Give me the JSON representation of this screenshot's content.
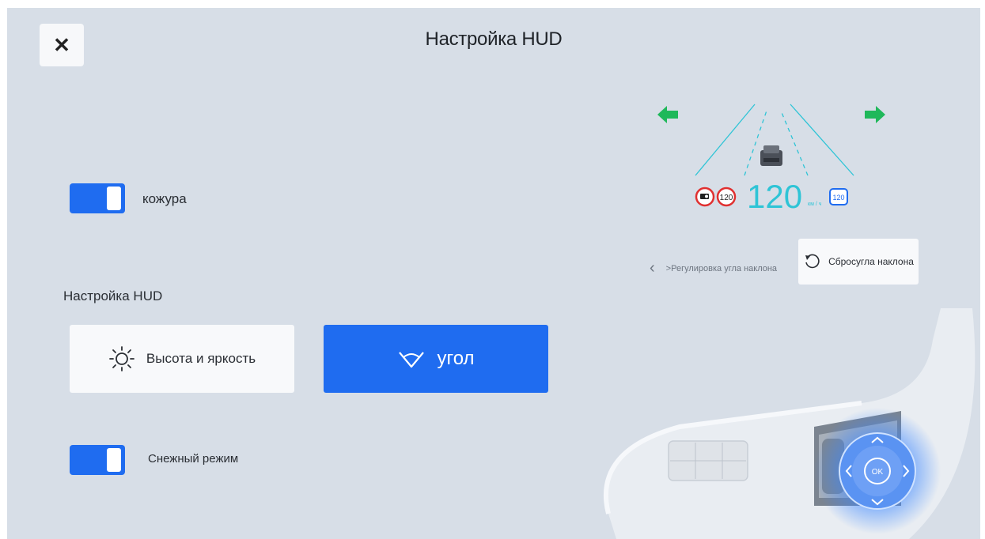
{
  "header": {
    "title": "Настройка HUD",
    "close_icon": "close-icon"
  },
  "toggles": [
    {
      "label": "кожура",
      "on": true
    },
    {
      "label": "Снежный режим",
      "on": true
    }
  ],
  "hud_settings": {
    "section_label": "Настройка HUD",
    "brightness_button": {
      "label": "Высота и яркость",
      "icon": "sun-icon"
    },
    "angle_button": {
      "label": "угол",
      "icon": "angle-icon",
      "active": true
    }
  },
  "hud_preview": {
    "speed": "120",
    "unit": "км / ч",
    "speed_limit": "120",
    "current_limit_badge": "120"
  },
  "tilt_control": {
    "nav_label": ">Регулировка угла наклона",
    "reset_label": "Сбросугла наклона",
    "reset_icon": "reset-icon"
  },
  "steering": {
    "ok_label": "OK"
  },
  "colors": {
    "accent": "#1f6cf0",
    "background": "#d7dee7",
    "hud_cyan": "#2ec4d6",
    "arrow_green": "#1fb85a"
  }
}
